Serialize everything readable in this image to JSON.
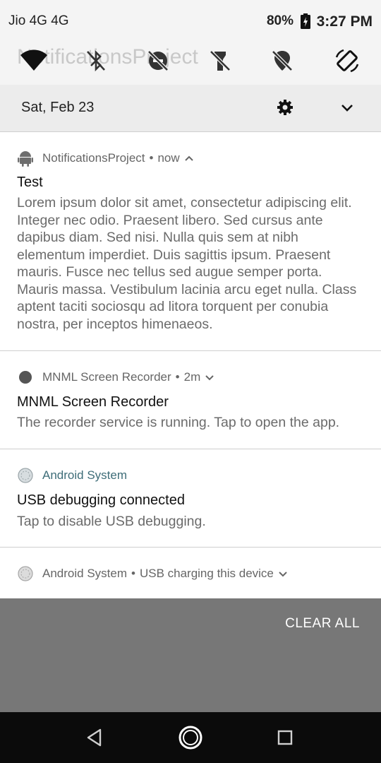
{
  "status_bar": {
    "carrier": "Jio 4G 4G",
    "battery_percent": "80%",
    "clock": "3:27 PM"
  },
  "quick_settings": {
    "ghost_title": "NotificationsProject",
    "tiles": [
      {
        "name": "wifi-icon",
        "state": "on"
      },
      {
        "name": "bluetooth-off-icon",
        "state": "off"
      },
      {
        "name": "do-not-disturb-off-icon",
        "state": "off"
      },
      {
        "name": "flashlight-off-icon",
        "state": "off"
      },
      {
        "name": "location-off-icon",
        "state": "off"
      },
      {
        "name": "auto-rotate-icon",
        "state": "on"
      }
    ]
  },
  "header": {
    "date": "Sat, Feb 23"
  },
  "notifications": [
    {
      "app": "NotificationsProject",
      "time": "now",
      "title": "Test",
      "body": "Lorem ipsum dolor sit amet, consectetur adipiscing elit. Integer nec odio. Praesent libero. Sed cursus ante dapibus diam. Sed nisi. Nulla quis sem at nibh elementum imperdiet. Duis sagittis ipsum. Praesent mauris. Fusce nec tellus sed augue semper porta. Mauris massa. Vestibulum lacinia arcu eget nulla. Class aptent taciti sociosqu ad litora torquent per conubia nostra, per inceptos himenaeos."
    },
    {
      "app": "MNML Screen Recorder",
      "time": "2m",
      "title": "MNML Screen Recorder",
      "body": "The recorder service is running. Tap to open the app."
    },
    {
      "app": "Android System",
      "title": "USB debugging connected",
      "body": "Tap to disable USB debugging."
    },
    {
      "app": "Android System",
      "summary": "USB charging this device"
    }
  ],
  "actions": {
    "clear_all": "CLEAR ALL"
  },
  "colors": {
    "accent_teal": "#3e6d78",
    "scrim": "#777777",
    "navbar": "#0b0b0b"
  }
}
